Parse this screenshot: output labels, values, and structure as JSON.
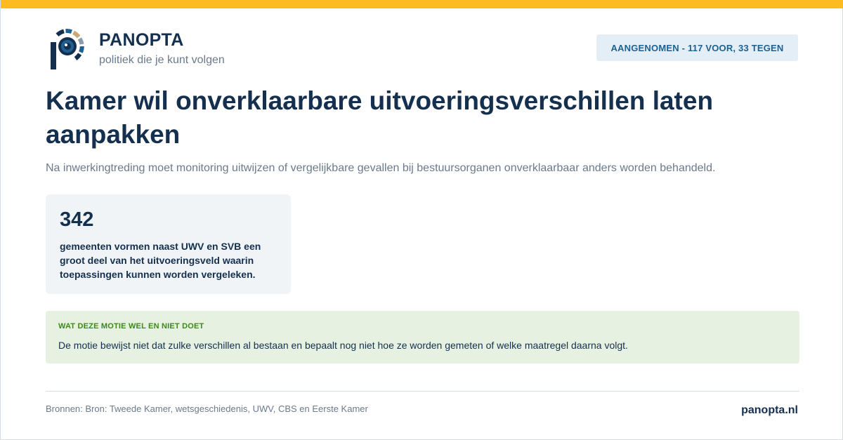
{
  "brand": {
    "name": "PANOPTA",
    "tagline": "politiek die je kunt volgen",
    "colors": {
      "accent": "#fbbb21",
      "navy": "#14304e",
      "eye": "#1d6193"
    }
  },
  "status": {
    "label": "AANGENOMEN - 117 VOOR, 33 TEGEN"
  },
  "headline": {
    "title": "Kamer wil onverklaarbare uitvoeringsverschillen laten aanpakken",
    "subtitle": "Na inwerkingtreding moet monitoring uitwijzen of vergelijkbare gevallen bij bestuursorganen onverklaarbaar anders worden behandeld."
  },
  "stat": {
    "value": "342",
    "label": "gemeenten vormen naast UWV en SVB een groot deel van het uitvoeringsveld waarin toepassingen kunnen worden vergeleken."
  },
  "note": {
    "heading": "WAT DEZE MOTIE WEL EN NIET DOET",
    "text": "De motie bewijst niet dat zulke verschillen al bestaan en bepaalt nog niet hoe ze worden gemeten of welke maatregel daarna volgt.",
    "color": "#3c8a13"
  },
  "footer": {
    "sources": "Bronnen: Bron: Tweede Kamer, wetsgeschiedenis, UWV, CBS en Eerste Kamer",
    "site": "panopta.nl"
  }
}
